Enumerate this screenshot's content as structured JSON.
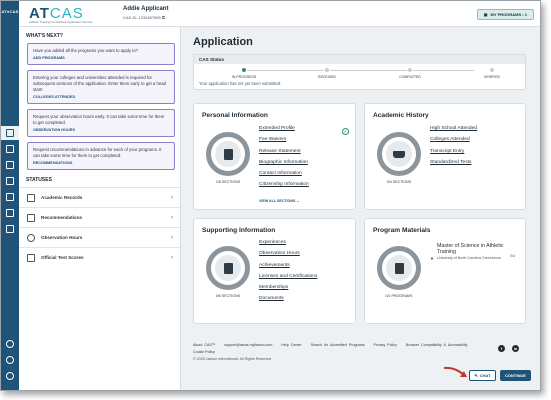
{
  "rail": {
    "brand": "AT●CAS"
  },
  "header": {
    "logo_main": "AT",
    "logo_cas": "CAS",
    "logo_sub": "Athletic Training Centralized Application Service",
    "user_name": "Addie Applicant",
    "cas_id": "CAS ID: 1234567890",
    "programs_button": "MY PROGRAMS • 1"
  },
  "whats_next": {
    "title": "WHAT'S NEXT?",
    "cards": [
      {
        "text": "Have you added all the programs you want to apply to?",
        "link": "ADD PROGRAMS"
      },
      {
        "text": "Entering your colleges and universities attended is required for subsequent sections of the application. Enter them early to get a head start!",
        "link": "COLLEGES ATTENDED"
      },
      {
        "text": "Request your observation hours early. It can take some time for them to get completed.",
        "link": "OBSERVATION HOURS"
      },
      {
        "text": "Request recommendations in advance for each of your programs. It can take some time for them to get completed.",
        "link": "RECOMMENDATIONS"
      }
    ]
  },
  "statuses": {
    "title": "STATUSES",
    "items": [
      "Academic Records",
      "Recommendations",
      "Observation Hours",
      "Official Test Scores"
    ]
  },
  "main": {
    "title": "Application",
    "cas_status": {
      "label": "CAS Status",
      "steps": [
        "IN PROGRESS",
        "RECEIVED",
        "COMPLETED",
        "VERIFIED"
      ],
      "current_step": 1,
      "note": "Your application has not yet been submitted."
    },
    "personal": {
      "title": "Personal Information",
      "sections": "1/8 SECTIONS",
      "links": [
        "Extended Profile",
        "Fee Waivers",
        "Release Statement",
        "Biographic Information",
        "Contact Information",
        "Citizenship Information"
      ],
      "view_all": "VIEW ALL SECTIONS"
    },
    "academic": {
      "title": "Academic History",
      "sections": "0/4 SECTIONS",
      "links": [
        "High School Attended",
        "Colleges Attended",
        "Transcript Entry",
        "Standardized Tests"
      ]
    },
    "supporting": {
      "title": "Supporting Information",
      "sections": "0/6 SECTIONS",
      "links": [
        "Experiences",
        "Observation Hours",
        "Achievements",
        "Licenses and Certifications",
        "Memberships",
        "Documents"
      ]
    },
    "program": {
      "title": "Program Materials",
      "sections": "0/1 PROGRAMS",
      "program_name": "Master of Science in Athletic Training",
      "program_school": "University of North Carolina Greensboro",
      "program_count": "0/4"
    }
  },
  "footer": {
    "links": [
      "About CAS™",
      "support@atcas.myliaison.com",
      "Help Center",
      "Search for Accredited Programs",
      "Privacy Policy",
      "Browser Compatibility & Accessibility"
    ],
    "cookie": "Cookie Policy",
    "copyright": "© 2026 Liaison International. All Rights Reserved",
    "social": [
      "f",
      "in"
    ]
  },
  "buttons": {
    "chat": "CHAT",
    "continue": "CONTINUE"
  },
  "colors": {
    "rail": "#1f5378",
    "accent": "#2bb3c8",
    "done": "#2e8f6e",
    "next_border": "#8d7fc9",
    "arrow": "#c0392b"
  }
}
